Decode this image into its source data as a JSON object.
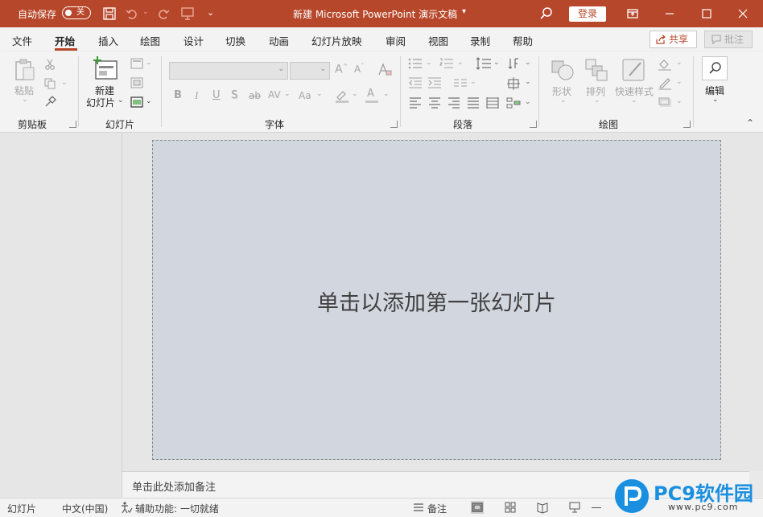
{
  "titlebar": {
    "autosave_label": "自动保存",
    "autosave_state": "关",
    "title": "新建 Microsoft PowerPoint 演示文稿",
    "login": "登录"
  },
  "tabs": [
    {
      "label": "文件"
    },
    {
      "label": "开始"
    },
    {
      "label": "插入"
    },
    {
      "label": "绘图"
    },
    {
      "label": "设计"
    },
    {
      "label": "切换"
    },
    {
      "label": "动画"
    },
    {
      "label": "幻灯片放映"
    },
    {
      "label": "审阅"
    },
    {
      "label": "视图"
    },
    {
      "label": "录制"
    },
    {
      "label": "帮助"
    }
  ],
  "active_tab": "开始",
  "share_label": "共享",
  "comment_label": "批注",
  "ribbon": {
    "clipboard": {
      "paste": "粘贴",
      "group": "剪贴板"
    },
    "slides": {
      "new_slide_line1": "新建",
      "new_slide_line2": "幻灯片",
      "group": "幻灯片"
    },
    "font": {
      "group": "字体",
      "bold": "B",
      "italic": "I",
      "underline": "U",
      "shadow": "S",
      "strike": "ab",
      "spacing": "AV",
      "case": "Aa",
      "fontcolor": "A"
    },
    "paragraph": {
      "group": "段落"
    },
    "drawing": {
      "shapes": "形状",
      "arrange": "排列",
      "quick_styles": "快速样式",
      "group": "绘图"
    },
    "editing": {
      "label": "编辑"
    }
  },
  "slide": {
    "placeholder": "单击以添加第一张幻灯片"
  },
  "notes": {
    "placeholder": "单击此处添加备注"
  },
  "statusbar": {
    "slide": "幻灯片",
    "language": "中文(中国)",
    "accessibility": "辅助功能: 一切就绪",
    "notes": "备注"
  },
  "watermark": {
    "text": "PC9软件园",
    "url": "www.pc9.com"
  },
  "colors": {
    "accent": "#b7472a",
    "slide_bg": "#d2d6df"
  }
}
